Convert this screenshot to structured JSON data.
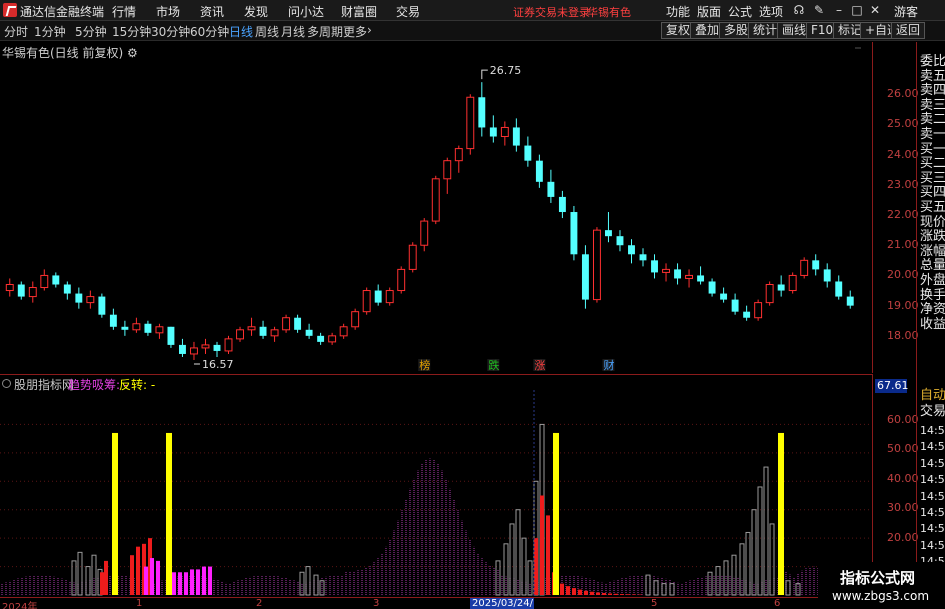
{
  "app": {
    "title": "通达信金融终端",
    "menu": [
      "行情",
      "市场",
      "资讯",
      "发现",
      "问小达",
      "财富圈",
      "交易"
    ],
    "account_status": "证券交易未登录",
    "stock_name": "华锡有色",
    "right_menu": [
      "功能",
      "版面",
      "公式",
      "选项"
    ],
    "guest": "游客"
  },
  "toolbar": {
    "periods": [
      "分时",
      "1分钟",
      "5分钟",
      "15分钟",
      "30分钟",
      "60分钟",
      "日线",
      "周线",
      "月线",
      "多周期",
      "更多"
    ],
    "active_period": "日线",
    "buttons": [
      "复权",
      "叠加",
      "多股",
      "统计",
      "画线",
      "F10",
      "标记",
      "+自选",
      "返回"
    ]
  },
  "main_chart": {
    "label": "华锡有色(日线 前复权)",
    "high_label": "26.75",
    "low_label": "16.57",
    "event_markers": [
      {
        "text": "榜",
        "color": "#e0a000"
      },
      {
        "text": "跌",
        "color": "#20c020"
      },
      {
        "text": "涨",
        "color": "#ff4040"
      },
      {
        "text": "财",
        "color": "#4aa3ff"
      }
    ],
    "y_ticks": [
      "26.00",
      "25.00",
      "24.00",
      "23.00",
      "22.00",
      "21.00",
      "20.00",
      "19.00",
      "18.00"
    ]
  },
  "indicator": {
    "source": "股朋指标网",
    "trend_label": "趋势吸筹:",
    "trend_value": "-",
    "reverse_label": "反转:",
    "reverse_value": "-",
    "current_value": "67.61",
    "y_ticks": [
      "60.00",
      "50.00",
      "40.00",
      "30.00",
      "20.00",
      "10.00"
    ]
  },
  "date_axis": {
    "labels": [
      "2024年",
      "1",
      "2",
      "3",
      "4",
      "5",
      "6"
    ],
    "cursor_label": "2025/03/24/一"
  },
  "right_panel": {
    "items": [
      "委比",
      "卖五",
      "卖四",
      "卖三",
      "卖二",
      "卖一",
      "买一",
      "买二",
      "买三",
      "买四",
      "买五",
      "现价",
      "涨跌",
      "涨幅",
      "总量",
      "外盘",
      "换手",
      "净资",
      "收益"
    ],
    "auto_label": "自动",
    "trade_label": "交易",
    "times": [
      "14:56",
      "14:56",
      "14:56",
      "14:56",
      "14:56",
      "14:56",
      "14:56",
      "14:56",
      "14:56"
    ]
  },
  "watermark": {
    "title": "指标公式网",
    "url": "www.zbgs3.com"
  },
  "chart_data": [
    {
      "type": "candlestick",
      "title": "华锡有色(日线 前复权)",
      "ylim": [
        17.2,
        27.2
      ],
      "points": [
        [
          19.5,
          19.9,
          19.3,
          19.7
        ],
        [
          19.7,
          19.8,
          19.2,
          19.3
        ],
        [
          19.3,
          19.8,
          19.1,
          19.6
        ],
        [
          19.6,
          20.2,
          19.5,
          20.0
        ],
        [
          20.0,
          20.1,
          19.6,
          19.7
        ],
        [
          19.7,
          19.8,
          19.2,
          19.4
        ],
        [
          19.4,
          19.6,
          18.9,
          19.1
        ],
        [
          19.1,
          19.5,
          18.9,
          19.3
        ],
        [
          19.3,
          19.4,
          18.6,
          18.7
        ],
        [
          18.7,
          18.9,
          18.2,
          18.3
        ],
        [
          18.3,
          18.5,
          18.0,
          18.2
        ],
        [
          18.2,
          18.6,
          18.1,
          18.4
        ],
        [
          18.4,
          18.5,
          18.0,
          18.1
        ],
        [
          18.1,
          18.4,
          17.9,
          18.3
        ],
        [
          18.3,
          18.3,
          17.6,
          17.7
        ],
        [
          17.7,
          17.9,
          17.3,
          17.4
        ],
        [
          17.4,
          17.8,
          17.2,
          17.6
        ],
        [
          17.6,
          17.9,
          17.4,
          17.7
        ],
        [
          17.7,
          17.8,
          17.3,
          17.5
        ],
        [
          17.5,
          18.0,
          17.4,
          17.9
        ],
        [
          17.9,
          18.3,
          17.8,
          18.2
        ],
        [
          18.2,
          18.6,
          18.0,
          18.3
        ],
        [
          18.3,
          18.5,
          17.9,
          18.0
        ],
        [
          18.0,
          18.3,
          17.8,
          18.2
        ],
        [
          18.2,
          18.7,
          18.1,
          18.6
        ],
        [
          18.6,
          18.7,
          18.1,
          18.2
        ],
        [
          18.2,
          18.4,
          17.9,
          18.0
        ],
        [
          18.0,
          18.1,
          17.7,
          17.8
        ],
        [
          17.8,
          18.1,
          17.7,
          18.0
        ],
        [
          18.0,
          18.4,
          17.9,
          18.3
        ],
        [
          18.3,
          18.9,
          18.2,
          18.8
        ],
        [
          18.8,
          19.6,
          18.7,
          19.5
        ],
        [
          19.5,
          19.7,
          19.0,
          19.1
        ],
        [
          19.1,
          19.6,
          19.0,
          19.5
        ],
        [
          19.5,
          20.3,
          19.4,
          20.2
        ],
        [
          20.2,
          21.1,
          20.1,
          21.0
        ],
        [
          21.0,
          21.9,
          20.8,
          21.8
        ],
        [
          21.8,
          23.3,
          21.7,
          23.2
        ],
        [
          23.2,
          23.9,
          22.7,
          23.8
        ],
        [
          23.8,
          24.3,
          23.4,
          24.2
        ],
        [
          24.2,
          26.0,
          24.0,
          25.9
        ],
        [
          25.9,
          26.4,
          24.6,
          24.9
        ],
        [
          24.9,
          25.3,
          24.4,
          24.6
        ],
        [
          24.6,
          25.1,
          24.3,
          24.9
        ],
        [
          24.9,
          25.2,
          24.1,
          24.3
        ],
        [
          24.3,
          24.6,
          23.6,
          23.8
        ],
        [
          23.8,
          24.0,
          22.9,
          23.1
        ],
        [
          23.1,
          23.5,
          22.4,
          22.6
        ],
        [
          22.6,
          22.8,
          21.9,
          22.1
        ],
        [
          22.1,
          22.3,
          20.5,
          20.7
        ],
        [
          20.7,
          21.0,
          18.9,
          19.2
        ],
        [
          19.2,
          21.6,
          19.1,
          21.5
        ],
        [
          21.5,
          22.1,
          21.1,
          21.3
        ],
        [
          21.3,
          21.5,
          20.8,
          21.0
        ],
        [
          21.0,
          21.2,
          20.4,
          20.7
        ],
        [
          20.7,
          20.9,
          20.3,
          20.5
        ],
        [
          20.5,
          20.7,
          19.9,
          20.1
        ],
        [
          20.1,
          20.4,
          19.8,
          20.2
        ],
        [
          20.2,
          20.4,
          19.7,
          19.9
        ],
        [
          19.9,
          20.2,
          19.6,
          20.0
        ],
        [
          20.0,
          20.3,
          19.7,
          19.8
        ],
        [
          19.8,
          19.9,
          19.3,
          19.4
        ],
        [
          19.4,
          19.6,
          19.1,
          19.2
        ],
        [
          19.2,
          19.4,
          18.7,
          18.8
        ],
        [
          18.8,
          19.0,
          18.5,
          18.6
        ],
        [
          18.6,
          19.2,
          18.5,
          19.1
        ],
        [
          19.1,
          19.8,
          19.0,
          19.7
        ],
        [
          19.7,
          20.0,
          19.3,
          19.5
        ],
        [
          19.5,
          20.1,
          19.4,
          20.0
        ],
        [
          20.0,
          20.6,
          19.9,
          20.5
        ],
        [
          20.5,
          20.7,
          20.0,
          20.2
        ],
        [
          20.2,
          20.4,
          19.6,
          19.8
        ],
        [
          19.8,
          20.0,
          19.2,
          19.3
        ],
        [
          19.3,
          19.5,
          18.9,
          19.0
        ]
      ]
    },
    {
      "type": "bar",
      "title": "股朋指标网",
      "ylim": [
        0,
        70
      ],
      "series": [
        {
          "name": "趋势吸筹",
          "values": [
            0,
            0,
            0,
            0,
            0,
            0,
            0,
            0,
            0,
            0,
            0,
            0,
            0,
            0,
            0,
            0,
            0,
            0,
            0,
            0,
            0,
            0,
            0,
            0,
            0,
            0,
            0,
            0,
            0,
            0,
            0,
            0,
            0,
            0,
            0,
            0,
            0,
            0,
            0,
            0,
            0,
            0,
            0,
            0,
            0,
            0,
            0,
            0,
            0,
            0,
            0,
            0,
            0,
            0,
            0,
            0,
            0,
            0,
            0,
            0,
            0,
            0,
            0,
            0,
            0,
            0,
            0,
            0,
            0,
            0,
            0,
            0,
            0,
            0,
            0,
            0,
            0,
            0,
            0,
            0,
            0,
            0,
            0,
            0,
            0,
            0,
            0,
            0,
            0,
            0,
            0,
            0,
            0,
            0,
            0,
            0,
            0,
            0,
            0,
            0,
            0,
            0,
            0,
            0,
            0,
            0,
            0,
            0,
            0,
            0,
            0,
            0,
            0,
            0,
            0,
            0,
            0,
            0,
            0,
            0,
            0,
            0,
            0,
            0,
            0,
            0,
            0,
            0,
            0,
            0,
            0,
            0,
            0,
            0,
            0,
            0,
            0,
            0,
            0,
            0,
            0,
            0,
            0,
            0,
            0,
            0,
            0,
            0,
            0,
            0,
            0,
            0,
            0,
            0,
            0,
            0,
            0,
            0,
            0,
            0,
            0,
            0,
            0,
            0,
            0,
            0,
            0,
            0,
            0,
            0,
            0,
            0,
            0,
            0,
            0,
            0,
            0,
            0,
            0,
            0,
            0,
            0,
            0,
            0,
            0,
            0,
            0,
            0,
            0,
            0,
            0,
            0,
            0,
            0,
            0,
            0,
            0,
            0,
            0,
            0,
            0,
            0,
            0,
            0,
            0,
            0,
            0,
            0,
            0,
            0,
            0,
            0,
            0,
            0,
            0,
            0,
            0,
            0,
            0,
            0,
            0,
            0,
            0,
            0,
            0,
            0
          ]
        },
        {
          "name": "反转",
          "values": [
            0,
            0,
            0,
            0,
            0,
            0,
            0,
            0,
            0,
            0,
            0,
            0,
            0,
            0,
            0,
            0,
            0,
            0,
            0,
            0,
            0,
            0,
            0,
            0,
            0,
            0,
            0,
            0,
            0,
            0,
            0,
            0,
            0,
            0,
            0,
            0,
            0,
            0,
            0,
            0,
            0,
            0,
            0,
            0,
            0,
            0,
            0,
            0,
            0,
            0,
            0,
            0,
            0,
            0,
            0,
            0,
            0,
            0,
            0,
            0,
            0,
            0,
            0,
            0,
            0,
            0,
            0,
            0,
            0,
            0,
            0,
            0,
            0,
            0,
            0,
            0,
            0,
            0,
            0,
            0,
            0,
            0,
            0,
            0,
            0,
            0,
            0,
            0,
            0,
            0,
            0,
            0,
            0,
            0,
            0,
            0,
            0,
            0,
            0,
            0,
            0,
            0,
            0,
            0,
            0,
            0,
            0,
            0,
            0,
            0,
            0,
            0,
            0,
            0,
            0,
            0,
            0,
            0,
            0,
            0,
            0,
            0,
            0,
            0,
            0,
            0,
            0,
            0,
            0,
            0,
            0,
            0,
            0,
            0,
            0,
            0,
            0,
            0,
            0,
            0,
            0,
            0,
            0,
            0,
            0,
            0,
            0,
            0,
            0,
            0,
            0,
            0,
            0,
            0,
            0,
            0,
            0,
            0,
            0,
            0,
            0,
            0,
            0,
            0,
            0,
            0,
            0,
            0,
            0,
            0,
            0,
            0,
            0,
            0,
            0,
            0,
            0,
            0,
            0,
            0,
            0,
            0,
            0,
            0,
            0,
            0,
            0,
            0,
            0,
            0,
            0,
            0,
            0,
            0,
            0,
            0,
            0,
            0,
            0,
            0,
            0,
            0,
            0,
            0,
            0,
            0,
            0,
            0,
            0,
            0,
            0,
            0,
            0,
            0,
            0,
            0,
            0,
            0,
            0,
            0,
            0,
            0,
            0,
            0,
            0,
            0
          ]
        }
      ]
    }
  ]
}
